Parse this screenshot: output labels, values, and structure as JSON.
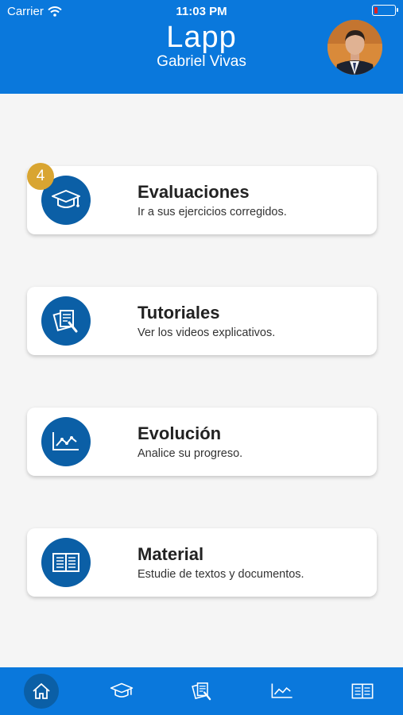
{
  "status_bar": {
    "carrier": "Carrier",
    "time": "11:03 PM",
    "battery_level": 0.15
  },
  "header": {
    "title": "Lapp",
    "user_name": "Gabriel Vivas"
  },
  "cards": [
    {
      "title": "Evaluaciones",
      "subtitle": "Ir a sus ejercicios corregidos.",
      "icon": "graduation-cap-icon",
      "badge": "4"
    },
    {
      "title": "Tutoriales",
      "subtitle": "Ver los videos explicativos.",
      "icon": "tutorial-docs-icon"
    },
    {
      "title": "Evolución",
      "subtitle": "Analice su progreso.",
      "icon": "line-chart-icon"
    },
    {
      "title": "Material",
      "subtitle": "Estudie de textos y documentos.",
      "icon": "book-icon"
    }
  ],
  "tab_bar": {
    "items": [
      {
        "icon": "home-icon",
        "active": true
      },
      {
        "icon": "graduation-cap-icon",
        "active": false
      },
      {
        "icon": "tutorial-docs-icon",
        "active": false
      },
      {
        "icon": "line-chart-icon",
        "active": false
      },
      {
        "icon": "book-icon",
        "active": false
      }
    ]
  },
  "colors": {
    "primary": "#0a78dc",
    "icon_circle": "#0b5fa6",
    "badge": "#d9a531",
    "background": "#f5f5f5"
  }
}
